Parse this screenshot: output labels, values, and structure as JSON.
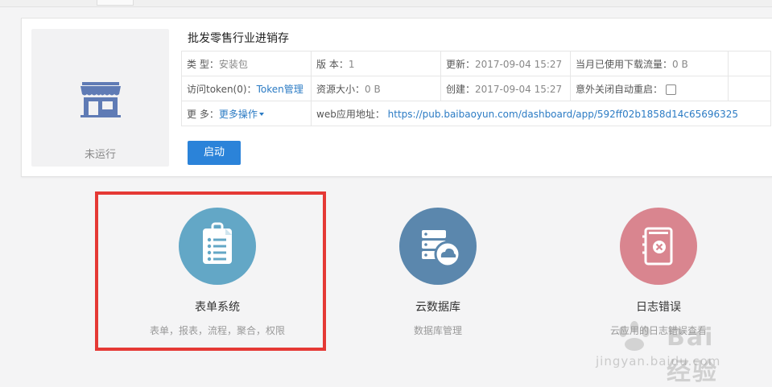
{
  "app": {
    "title": "批发零售行业进销存",
    "status": "未运行",
    "start_label": "启动"
  },
  "info": {
    "type_label": "类 型：",
    "type_value": "安装包",
    "version_label": "版 本：",
    "version_value": "1",
    "updated_label": "更新：",
    "updated_value": "2017-09-04 15:27",
    "traffic_label": "当月已使用下载流量：",
    "traffic_value": "0 B",
    "token_label": "访问token(0)：",
    "token_link": "Token管理",
    "size_label": "资源大小：",
    "size_value": "0 B",
    "created_label": "创建：",
    "created_value": "2017-09-04 15:27",
    "autorestart_label": "意外关闭自动重启：",
    "more_label": "更 多：",
    "more_link": "更多操作",
    "url_label": "web应用地址：",
    "url_value": "https://pub.baibaoyun.com/dashboard/app/592ff02b1858d14c65696325"
  },
  "features": [
    {
      "name": "表单系统",
      "desc": "表单，报表，流程，聚合，权限",
      "icon": "clipboard-icon",
      "color": "#63a7c6"
    },
    {
      "name": "云数据库",
      "desc": "数据库管理",
      "icon": "cloud-database-icon",
      "color": "#5b87ad"
    },
    {
      "name": "日志错误",
      "desc": "云应用的日志错误查看",
      "icon": "error-log-icon",
      "color": "#d9858f"
    }
  ],
  "watermark": {
    "brand": "Bai 经验",
    "url": "jingyan.baidu.com"
  },
  "colors": {
    "primary": "#2b83d9",
    "link": "#2b7bc4",
    "highlight": "#e53935",
    "store_icon": "#5f7bb5"
  }
}
